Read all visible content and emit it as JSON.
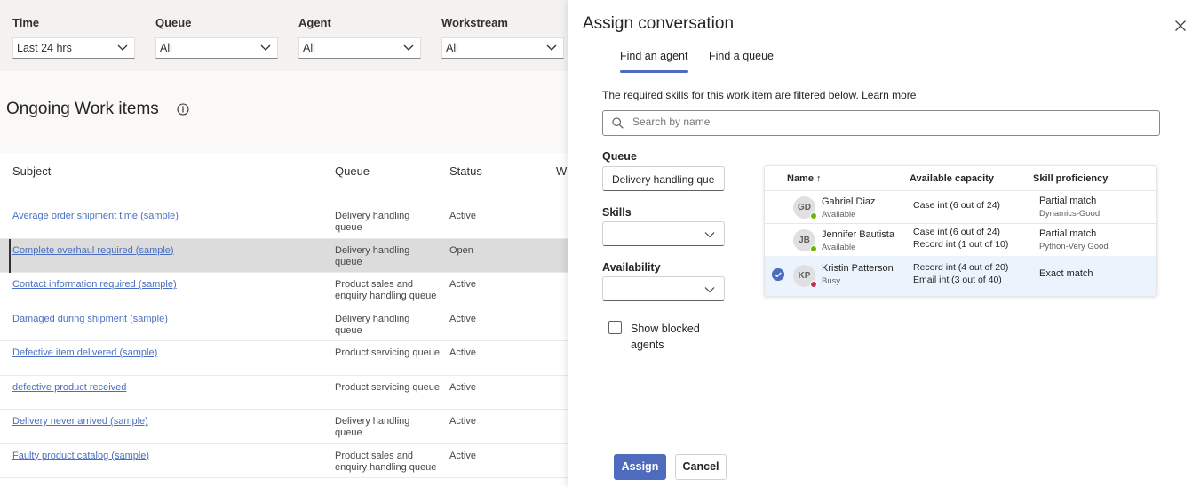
{
  "filters": [
    {
      "label": "Time",
      "value": "Last 24 hrs"
    },
    {
      "label": "Queue",
      "value": "All"
    },
    {
      "label": "Agent",
      "value": "All"
    },
    {
      "label": "Workstream",
      "value": "All"
    }
  ],
  "work_items": {
    "title": "Ongoing Work items",
    "columns": [
      "Subject",
      "Queue",
      "Status",
      "W"
    ],
    "rows": [
      {
        "subject": "Average order shipment time (sample)",
        "queue": "Delivery handling queue",
        "status": "Active"
      },
      {
        "subject": "Complete overhaul required (sample)",
        "queue": "Delivery handling queue",
        "status": "Open"
      },
      {
        "subject": "Contact information required (sample)",
        "queue": "Product sales and enquiry handling queue",
        "status": "Active"
      },
      {
        "subject": "Damaged during shipment (sample)",
        "queue": "Delivery handling queue",
        "status": "Active"
      },
      {
        "subject": "Defective item delivered (sample)",
        "queue": "Product servicing queue",
        "status": "Active"
      },
      {
        "subject": "defective product received",
        "queue": "Product servicing queue",
        "status": "Active"
      },
      {
        "subject": "Delivery never arrived (sample)",
        "queue": "Delivery handling queue",
        "status": "Active"
      },
      {
        "subject": "Faulty product catalog (sample)",
        "queue": "Product sales and enquiry handling queue",
        "status": "Active"
      }
    ]
  },
  "dialog": {
    "title": "Assign conversation",
    "tabs": [
      "Find an agent",
      "Find a queue"
    ],
    "description": "The required skills for this work item are filtered below. Learn more",
    "search_placeholder": "Search by name",
    "queue_label": "Queue",
    "queue_value": "Delivery handling queue",
    "skills_label": "Skills",
    "skills_value": "",
    "availability_label": "Availability",
    "availability_value": "",
    "show_blocked_label": "Show blocked agents",
    "agents_table": {
      "columns": [
        "Name ↑",
        "Available capacity",
        "Skill proficiency"
      ],
      "rows": [
        {
          "initials": "GD",
          "name": "Gabriel Diaz",
          "state": "Available",
          "capacity": [
            "Case int (6 out of 24)"
          ],
          "proficiency": "Partial match",
          "skill": "Dynamics-Good",
          "selected": false
        },
        {
          "initials": "JB",
          "name": "Jennifer Bautista",
          "state": "Available",
          "capacity": [
            "Case int (6 out of 24)",
            "Record int (1 out of 10)"
          ],
          "proficiency": "Partial match",
          "skill": "Python-Very Good",
          "selected": false
        },
        {
          "initials": "KP",
          "name": "Kristin Patterson",
          "state": "Busy",
          "capacity": [
            "Record int (4 out of 20)",
            "Email int (3 out of 40)"
          ],
          "proficiency": "Exact match",
          "skill": "",
          "selected": true
        }
      ]
    },
    "assign_label": "Assign",
    "cancel_label": "Cancel"
  },
  "colors": {
    "accent": "#4f6bbd",
    "available": "#6bb700",
    "busy": "#c4314b",
    "link": "#4a6fc1"
  }
}
